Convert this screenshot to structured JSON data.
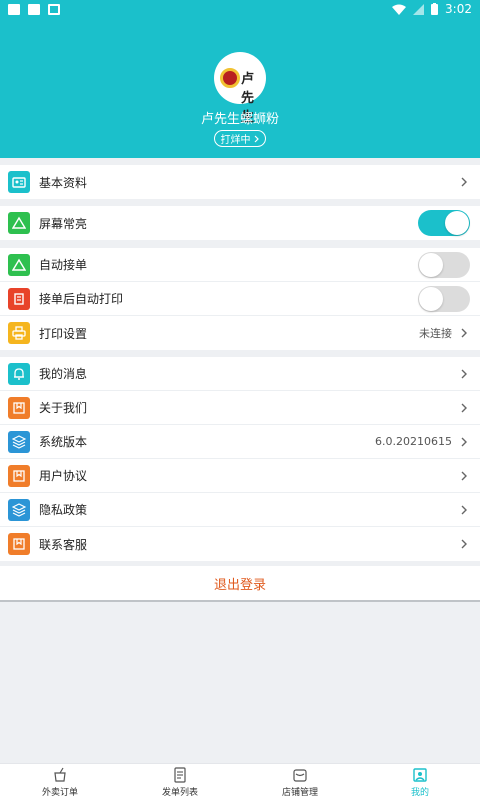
{
  "status_bar": {
    "time": "3:02"
  },
  "header": {
    "shop_name": "卢先生螺蛳粉",
    "shop_status": "打烊中",
    "logo_text": "卢先生"
  },
  "groups": [
    {
      "rows": [
        {
          "label": "基本资料",
          "icon": "profile-card-icon",
          "color": "#1bc0cb",
          "control": "chevron"
        }
      ]
    },
    {
      "rows": [
        {
          "label": "屏幕常亮",
          "icon": "triangle-icon",
          "color": "#2ec04f",
          "control": "toggle",
          "on": true
        }
      ]
    },
    {
      "rows": [
        {
          "label": "自动接单",
          "icon": "triangle-icon",
          "color": "#2ec04f",
          "control": "toggle",
          "on": false
        },
        {
          "label": "接单后自动打印",
          "icon": "receipt-icon",
          "color": "#e8432a",
          "control": "toggle",
          "on": false
        },
        {
          "label": "打印设置",
          "icon": "printer-icon",
          "color": "#f5b51e",
          "control": "chevron",
          "value": "未连接"
        }
      ]
    },
    {
      "rows": [
        {
          "label": "我的消息",
          "icon": "bell-icon",
          "color": "#1bc0cb",
          "control": "chevron"
        },
        {
          "label": "关于我们",
          "icon": "bookmark-icon",
          "color": "#f07d2a",
          "control": "chevron"
        },
        {
          "label": "系统版本",
          "icon": "layers-icon",
          "color": "#2b95d6",
          "control": "chevron",
          "value": "6.0.20210615"
        },
        {
          "label": "用户协议",
          "icon": "bookmark-icon",
          "color": "#f07d2a",
          "control": "chevron"
        },
        {
          "label": "隐私政策",
          "icon": "layers-icon",
          "color": "#2b95d6",
          "control": "chevron"
        },
        {
          "label": "联系客服",
          "icon": "bookmark-icon",
          "color": "#f07d2a",
          "control": "chevron"
        }
      ]
    }
  ],
  "logout_label": "退出登录",
  "tabs": [
    {
      "label": "外卖订单",
      "icon": "takeout-icon",
      "active": false
    },
    {
      "label": "发单列表",
      "icon": "list-icon",
      "active": false
    },
    {
      "label": "店铺管理",
      "icon": "store-icon",
      "active": false
    },
    {
      "label": "我的",
      "icon": "profile-icon",
      "active": true
    }
  ],
  "colors": {
    "accent": "#1bc0cb",
    "logout": "#e05a1e"
  }
}
